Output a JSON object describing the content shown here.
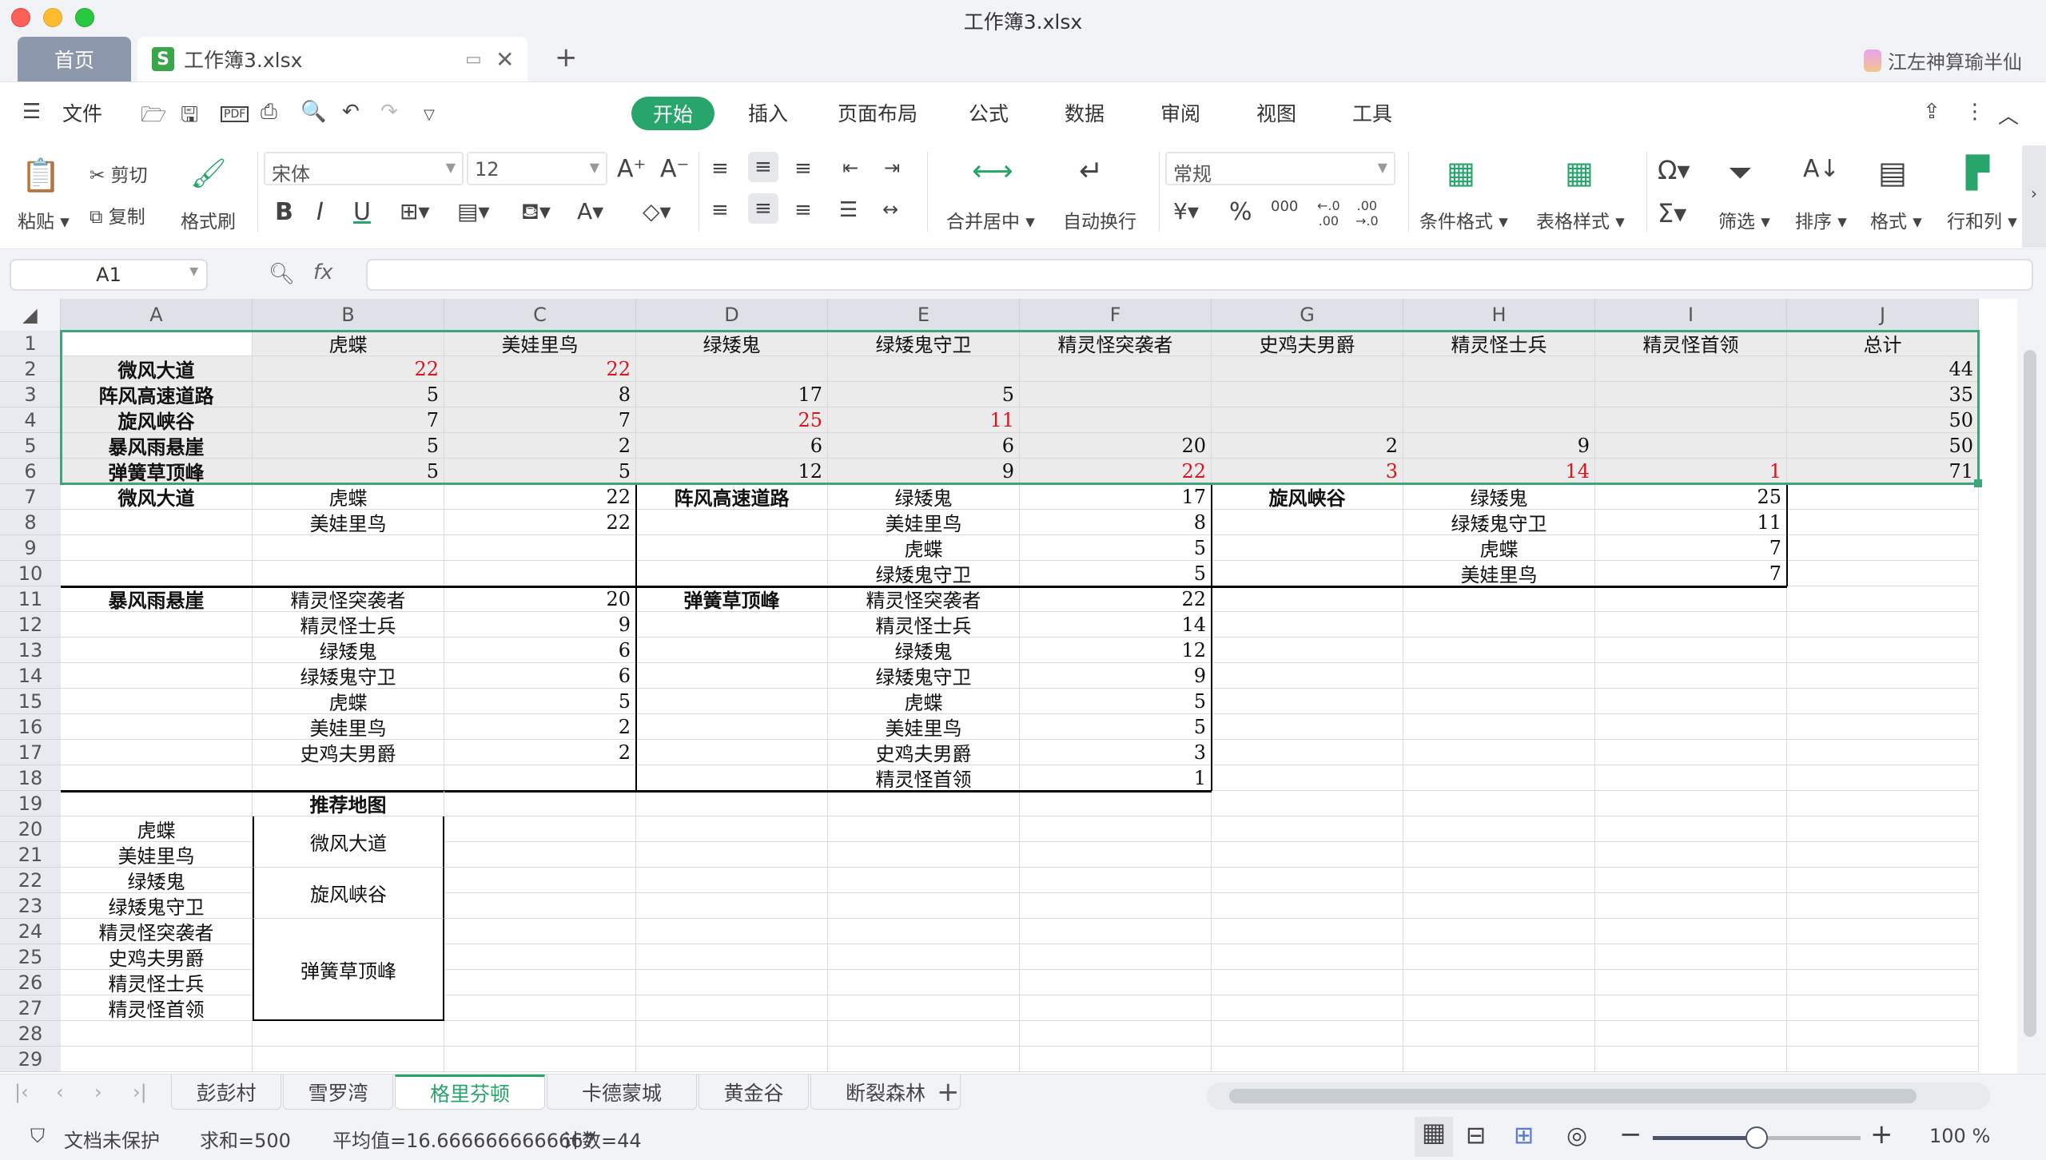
{
  "window": {
    "title": "工作簿3.xlsx"
  },
  "tabs": {
    "home": "首页",
    "doc": "工作簿3.xlsx",
    "doc_icon": "S",
    "new_tab": "+"
  },
  "user": {
    "name": "江左神算瑜半仙"
  },
  "menu": {
    "file": "文件",
    "tabs": [
      "开始",
      "插入",
      "页面布局",
      "公式",
      "数据",
      "审阅",
      "视图",
      "工具"
    ],
    "active": "开始"
  },
  "ribbon": {
    "paste": "粘贴",
    "cut": "剪切",
    "copy": "复制",
    "format_painter": "格式刷",
    "font": "宋体",
    "font_size": "12",
    "merge_center": "合并居中",
    "wrap": "自动换行",
    "number_format": "常规",
    "cond_format": "条件格式",
    "table_style": "表格样式",
    "filter": "筛选",
    "sort": "排序",
    "format": "格式",
    "rows_cols": "行和列"
  },
  "formula_bar": {
    "cell_ref": "A1",
    "fx": "fx",
    "value": ""
  },
  "columns": [
    "A",
    "B",
    "C",
    "D",
    "E",
    "F",
    "G",
    "H",
    "I",
    "J"
  ],
  "rows": [
    "1",
    "2",
    "3",
    "4",
    "5",
    "6",
    "7",
    "8",
    "9",
    "10",
    "11",
    "12",
    "13",
    "14",
    "15",
    "16",
    "17",
    "18",
    "19",
    "20",
    "21",
    "22",
    "23",
    "24",
    "25",
    "26",
    "27",
    "28",
    "29"
  ],
  "table": {
    "header": [
      "",
      "虎蝶",
      "美娃里鸟",
      "绿矮鬼",
      "绿矮鬼守卫",
      "精灵怪突袭者",
      "史鸡夫男爵",
      "精灵怪士兵",
      "精灵怪首领",
      "总计"
    ],
    "rows": [
      {
        "name": "微风大道",
        "values": [
          "22",
          "22",
          "",
          "",
          "",
          "",
          "",
          "",
          ""
        ],
        "total": "44",
        "red": [
          0,
          1
        ]
      },
      {
        "name": "阵风高速道路",
        "values": [
          "5",
          "8",
          "17",
          "5",
          "",
          "",
          "",
          "",
          ""
        ],
        "total": "35",
        "red": []
      },
      {
        "name": "旋风峡谷",
        "values": [
          "7",
          "7",
          "25",
          "11",
          "",
          "",
          "",
          "",
          ""
        ],
        "total": "50",
        "red": [
          2,
          3
        ]
      },
      {
        "name": "暴风雨悬崖",
        "values": [
          "5",
          "2",
          "6",
          "6",
          "20",
          "2",
          "9",
          ""
        ],
        "total": "50",
        "red": []
      },
      {
        "name": "弹簧草顶峰",
        "values": [
          "5",
          "5",
          "12",
          "9",
          "22",
          "3",
          "14",
          "1"
        ],
        "total": "71",
        "red": [
          4,
          5,
          6,
          7
        ]
      }
    ]
  },
  "blocks": [
    {
      "map": "微风大道",
      "items": [
        [
          "虎蝶",
          "22"
        ],
        [
          "美娃里鸟",
          "22"
        ]
      ]
    },
    {
      "map": "阵风高速道路",
      "items": [
        [
          "绿矮鬼",
          "17"
        ],
        [
          "美娃里鸟",
          "8"
        ],
        [
          "虎蝶",
          "5"
        ],
        [
          "绿矮鬼守卫",
          "5"
        ]
      ]
    },
    {
      "map": "旋风峡谷",
      "items": [
        [
          "绿矮鬼",
          "25"
        ],
        [
          "绿矮鬼守卫",
          "11"
        ],
        [
          "虎蝶",
          "7"
        ],
        [
          "美娃里鸟",
          "7"
        ]
      ]
    },
    {
      "map": "暴风雨悬崖",
      "items": [
        [
          "精灵怪突袭者",
          "20"
        ],
        [
          "精灵怪士兵",
          "9"
        ],
        [
          "绿矮鬼",
          "6"
        ],
        [
          "绿矮鬼守卫",
          "6"
        ],
        [
          "虎蝶",
          "5"
        ],
        [
          "美娃里鸟",
          "2"
        ],
        [
          "史鸡夫男爵",
          "2"
        ]
      ]
    },
    {
      "map": "弹簧草顶峰",
      "items": [
        [
          "精灵怪突袭者",
          "22"
        ],
        [
          "精灵怪士兵",
          "14"
        ],
        [
          "绿矮鬼",
          "12"
        ],
        [
          "绿矮鬼守卫",
          "9"
        ],
        [
          "虎蝶",
          "5"
        ],
        [
          "美娃里鸟",
          "5"
        ],
        [
          "史鸡夫男爵",
          "3"
        ],
        [
          "精灵怪首领",
          "1"
        ]
      ]
    }
  ],
  "recommend": {
    "title": "推荐地图",
    "monsters": [
      "虎蝶",
      "美娃里鸟",
      "绿矮鬼",
      "绿矮鬼守卫",
      "精灵怪突袭者",
      "史鸡夫男爵",
      "精灵怪士兵",
      "精灵怪首领"
    ],
    "maps": [
      "微风大道",
      "旋风峡谷",
      "弹簧草顶峰"
    ]
  },
  "sheets": [
    "彭彭村",
    "雪罗湾",
    "格里芬顿",
    "卡德蒙城",
    "黄金谷",
    "断裂森林"
  ],
  "active_sheet": "格里芬顿",
  "status": {
    "protect": "文档未保护",
    "sum": "求和=500",
    "avg": "平均值=16.6666666666667",
    "count": "计数=44",
    "zoom": "100 %",
    "zoom_fraction": 0.5
  },
  "colors": {
    "accent": "#27a56b",
    "selection": "#3aa67a",
    "red": "#d9141e"
  }
}
